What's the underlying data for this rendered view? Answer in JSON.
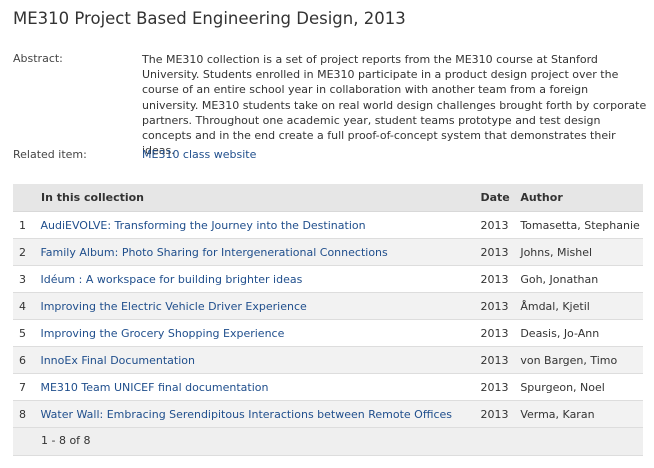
{
  "page": {
    "title": "ME310 Project Based Engineering Design, 2013"
  },
  "meta": {
    "abstract_label": "Abstract:",
    "abstract_text": "The ME310 collection is a set of project reports from the ME310 course at Stanford University. Students enrolled in ME310 participate in a product design project over the course of an entire school year in collaboration with another team from a foreign university. ME310 students take on real world design challenges brought forth by corporate partners. Throughout one academic year, student teams prototype and test design concepts and in the end create a full proof-of-concept system that demonstrates their ideas.",
    "related_label": "Related item:",
    "related_link": "ME310 class website"
  },
  "table": {
    "headers": {
      "collection": "In this collection",
      "date": "Date",
      "author": "Author"
    },
    "rows": [
      {
        "num": "1",
        "title": "AudiEVOLVE: Transforming the Journey into the Destination",
        "date": "2013",
        "author": "Tomasetta, Stephanie"
      },
      {
        "num": "2",
        "title": "Family Album: Photo Sharing for Intergenerational Connections",
        "date": "2013",
        "author": "Johns, Mishel"
      },
      {
        "num": "3",
        "title": "Idéum : A workspace for building brighter ideas",
        "date": "2013",
        "author": "Goh, Jonathan"
      },
      {
        "num": "4",
        "title": "Improving the Electric Vehicle Driver Experience",
        "date": "2013",
        "author": "Åmdal, Kjetil"
      },
      {
        "num": "5",
        "title": "Improving the Grocery Shopping Experience",
        "date": "2013",
        "author": "Deasis, Jo-Ann"
      },
      {
        "num": "6",
        "title": "InnoEx Final Documentation",
        "date": "2013",
        "author": "von Bargen, Timo"
      },
      {
        "num": "7",
        "title": "ME310 Team UNICEF final documentation",
        "date": "2013",
        "author": "Spurgeon, Noel"
      },
      {
        "num": "8",
        "title": "Water Wall: Embracing Serendipitous Interactions between Remote Offices",
        "date": "2013",
        "author": "Verma, Karan"
      }
    ],
    "pager": "1 - 8 of 8"
  },
  "colors": {
    "link": "#1f4e8c",
    "header_bg": "#e6e6e6",
    "stripe_bg": "#f2f2f2"
  }
}
